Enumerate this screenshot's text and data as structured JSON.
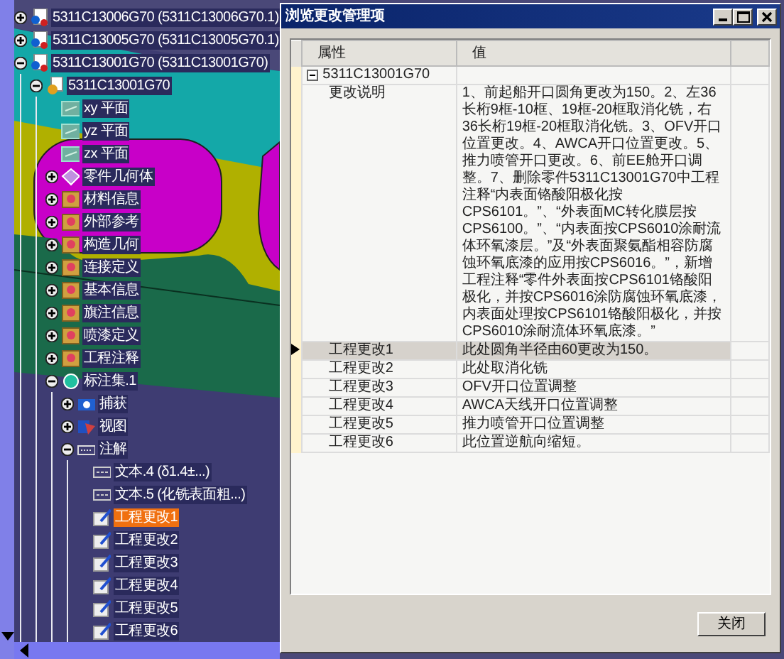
{
  "tree": [
    {
      "label": "5311C13006G70 (5311C13006G70.1)",
      "expanded": false,
      "selected": false,
      "kind": "product"
    },
    {
      "label": "5311C13005G70 (5311C13005G70.1)",
      "expanded": false,
      "selected": false,
      "kind": "product"
    },
    {
      "label": "5311C13001G70 (5311C13001G70)",
      "expanded": true,
      "selected": false,
      "kind": "product",
      "children": [
        {
          "label": "5311C13001G70",
          "expanded": true,
          "selected": false,
          "kind": "part",
          "children": [
            {
              "label": "xy 平面",
              "selected": false,
              "kind": "plane"
            },
            {
              "label": "yz 平面",
              "selected": false,
              "kind": "plane"
            },
            {
              "label": "zx 平面",
              "selected": false,
              "kind": "plane"
            },
            {
              "label": "零件几何体",
              "expanded": false,
              "selected": false,
              "kind": "body"
            },
            {
              "label": "材料信息",
              "expanded": false,
              "selected": false,
              "kind": "set"
            },
            {
              "label": "外部参考",
              "expanded": false,
              "selected": false,
              "kind": "set"
            },
            {
              "label": "构造几何",
              "expanded": false,
              "selected": false,
              "kind": "set"
            },
            {
              "label": "连接定义",
              "expanded": false,
              "selected": false,
              "kind": "set"
            },
            {
              "label": "基本信息",
              "expanded": false,
              "selected": false,
              "kind": "set"
            },
            {
              "label": "旗注信息",
              "expanded": false,
              "selected": false,
              "kind": "set"
            },
            {
              "label": "喷漆定义",
              "expanded": false,
              "selected": false,
              "kind": "set"
            },
            {
              "label": "工程注释",
              "expanded": false,
              "selected": false,
              "kind": "set"
            },
            {
              "label": "标注集.1",
              "expanded": true,
              "selected": false,
              "kind": "annset",
              "children": [
                {
                  "label": "捕获",
                  "expanded": false,
                  "selected": false,
                  "kind": "capture"
                },
                {
                  "label": "视图",
                  "expanded": false,
                  "selected": false,
                  "kind": "view"
                },
                {
                  "label": "注解",
                  "expanded": true,
                  "selected": false,
                  "kind": "notes",
                  "children": [
                    {
                      "label": "文本.4 (δ1.4±...)",
                      "selected": false,
                      "kind": "text"
                    },
                    {
                      "label": "文本.5 (化铣表面粗...)",
                      "selected": false,
                      "kind": "text"
                    },
                    {
                      "label": "工程更改1",
                      "selected": true,
                      "kind": "note"
                    },
                    {
                      "label": "工程更改2",
                      "selected": false,
                      "kind": "note"
                    },
                    {
                      "label": "工程更改3",
                      "selected": false,
                      "kind": "note"
                    },
                    {
                      "label": "工程更改4",
                      "selected": false,
                      "kind": "note"
                    },
                    {
                      "label": "工程更改5",
                      "selected": false,
                      "kind": "note"
                    },
                    {
                      "label": "工程更改6",
                      "selected": false,
                      "kind": "note"
                    }
                  ]
                }
              ]
            }
          ]
        }
      ]
    }
  ],
  "dialog": {
    "title": "浏览更改管理项",
    "columns": [
      "属性",
      "值"
    ],
    "group": {
      "label": "5311C13001G70",
      "expanded": true
    },
    "description": {
      "label": "更改说明",
      "value": "1、前起船开口圆角更改为150。2、左36长桁9框-10框、19框-20框取消化铣，右36长桁19框-20框取消化铣。3、OFV开口位置更改。4、AWCA开口位置更改。5、推力喷管开口更改。6、前EE舱开口调整。7、删除零件5311C13001G70中工程注释“内表面铬酸阳极化按CPS6101。”、“外表面MC转化膜层按CPS6100。”、“内表面按CPS6010涂耐流体环氧漆层。”及“外表面聚氨酯相容防腐蚀环氧底漆的应用按CPS6016。”，新增工程注释“零件外表面按CPS6101铬酸阳极化，并按CPS6016涂防腐蚀环氧底漆，内表面处理按CPS6101铬酸阳极化，并按CPS6010涂耐流体环氧底漆。”"
    },
    "rows": [
      {
        "name": "工程更改1",
        "value": "此处圆角半径由60更改为150。",
        "selected": true
      },
      {
        "name": "工程更改2",
        "value": "此处取消化铣",
        "selected": false
      },
      {
        "name": "工程更改3",
        "value": "OFV开口位置调整",
        "selected": false
      },
      {
        "name": "工程更改4",
        "value": "AWCA天线开口位置调整",
        "selected": false
      },
      {
        "name": "工程更改5",
        "value": "推力喷管开口位置调整",
        "selected": false
      },
      {
        "name": "工程更改6",
        "value": "此位置逆航向缩短。",
        "selected": false
      }
    ],
    "close_button": "关闭"
  }
}
